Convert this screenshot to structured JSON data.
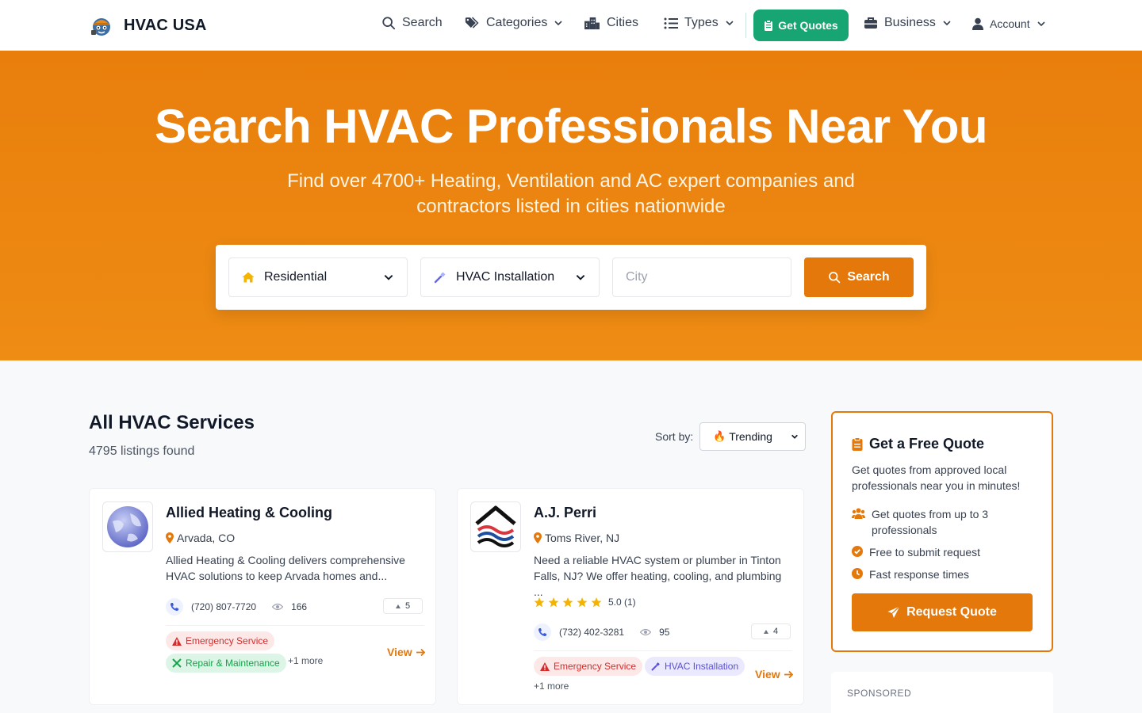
{
  "brand": {
    "name": "HVAC USA"
  },
  "nav": {
    "search": "Search",
    "categories": "Categories",
    "cities": "Cities",
    "types": "Types",
    "get_quotes": "Get Quotes",
    "business": "Business",
    "account": "Account"
  },
  "hero": {
    "title": "Search HVAC Professionals Near You",
    "subtitle": "Find over 4700+ Heating, Ventilation and AC expert companies and contractors listed in cities nationwide"
  },
  "search_bar": {
    "type_value": "Residential",
    "service_value": "HVAC Installation",
    "city_placeholder": "City",
    "button": "Search"
  },
  "listings": {
    "title": "All HVAC Services",
    "count": "4795 listings found",
    "sort_label": "Sort by:",
    "sort_value": "Trending",
    "sort_emoji": "🔥",
    "cards": [
      {
        "name": "Allied Heating & Cooling",
        "location": "Arvada, CO",
        "description": "Allied Heating & Cooling delivers comprehensive HVAC solutions to keep Arvada homes and...",
        "phone": "(720) 807-7720",
        "views": "166",
        "votes": "5",
        "tags": [
          "Emergency Service",
          "Repair & Maintenance"
        ],
        "more": "+1 more",
        "view": "View"
      },
      {
        "name": "A.J. Perri",
        "location": "Toms River, NJ",
        "description": "Need a reliable HVAC system or plumber in Tinton Falls, NJ? We offer heating, cooling, and plumbing ...",
        "rating": "5.0 (1)",
        "stars": 5,
        "phone": "(732) 402-3281",
        "views": "95",
        "votes": "4",
        "tags": [
          "Emergency Service",
          "HVAC Installation"
        ],
        "more": "+1 more",
        "view": "View"
      }
    ]
  },
  "quote_box": {
    "title": "Get a Free Quote",
    "description": "Get quotes from approved local professionals near you in minutes!",
    "benefits": [
      "Get quotes from up to 3 professionals",
      "Free to submit request",
      "Fast response times"
    ],
    "button": "Request Quote"
  },
  "sponsored": {
    "label": "SPONSORED"
  },
  "colors": {
    "primary": "#e5780a",
    "green": "#17a673"
  }
}
